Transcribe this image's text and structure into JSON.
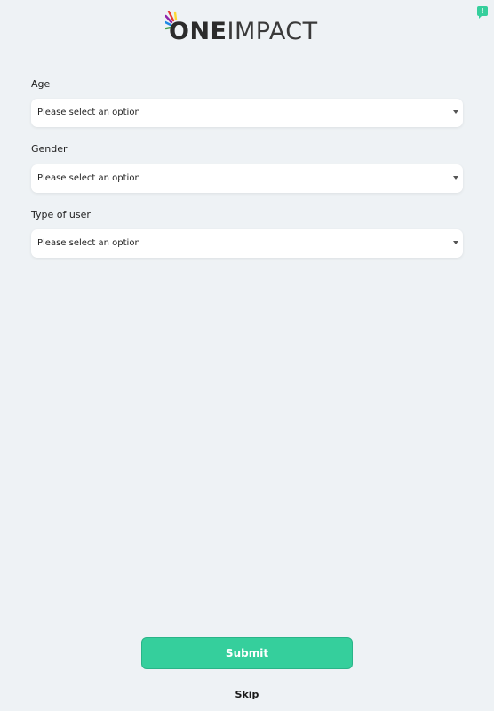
{
  "feedback_badge": {
    "icon": "feedback-icon",
    "label": "!"
  },
  "logo": {
    "part_bold": "ONE",
    "part_thin": "IMPACT",
    "burst_colors": [
      "#e53935",
      "#8e24aa",
      "#1e88e5",
      "#fdd835",
      "#43a047"
    ]
  },
  "form": {
    "fields": [
      {
        "label": "Age",
        "placeholder": "Please select an option"
      },
      {
        "label": "Gender",
        "placeholder": "Please select an option"
      },
      {
        "label": "Type of user",
        "placeholder": "Please select an option"
      }
    ]
  },
  "actions": {
    "submit_label": "Submit",
    "skip_label": "Skip"
  },
  "colors": {
    "background": "#eef2f5",
    "accent": "#35cf9c"
  }
}
